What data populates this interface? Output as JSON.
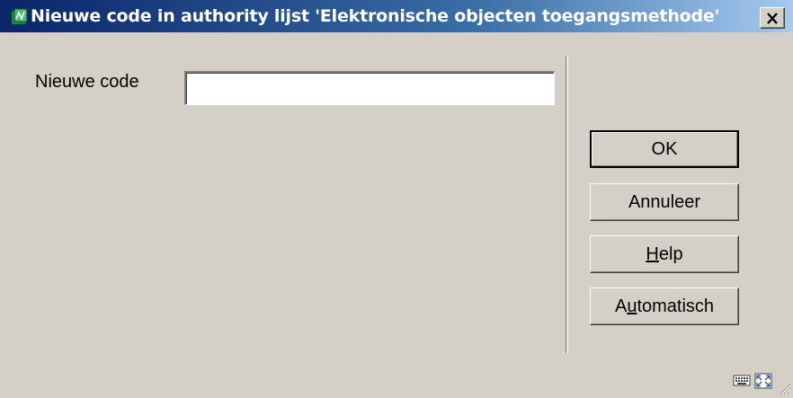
{
  "window": {
    "title": "Nieuwe code in authority lijst 'Elektronische objecten toegangsmethode'",
    "icon": "app-icon",
    "close_icon": "close-icon"
  },
  "form": {
    "code_label": "Nieuwe code",
    "code_value": "",
    "code_placeholder": ""
  },
  "buttons": {
    "ok": "OK",
    "cancel": "Annuleer",
    "help_pre": "",
    "help_mnemonic": "H",
    "help_post": "elp",
    "auto_pre": "A",
    "auto_mnemonic": "u",
    "auto_post": "tomatisch"
  },
  "status": {
    "icons": [
      "keyboard-icon",
      "resize-icon"
    ]
  },
  "colors": {
    "titlebar_start": "#0a246a",
    "titlebar_end": "#a6caf0",
    "face": "#d4d0c8"
  }
}
